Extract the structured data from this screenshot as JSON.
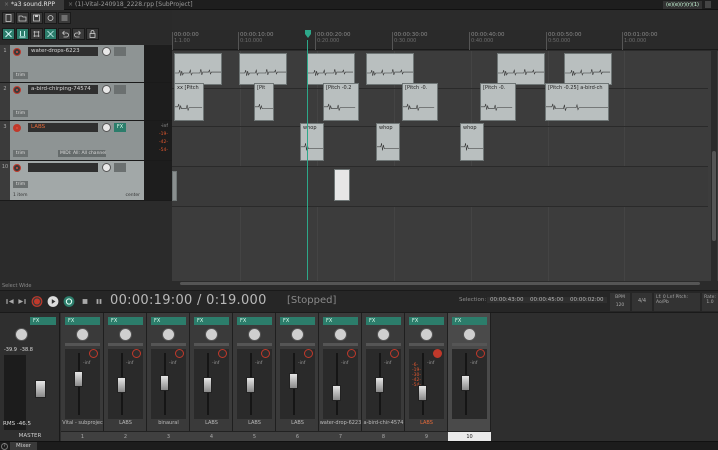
{
  "tabs": [
    {
      "label": "*a3 sound.RPP",
      "active": true
    },
    {
      "label": "(1)-Vital-240918_2228.rpp [SubProject]",
      "active": false
    }
  ],
  "topright_label": "(e)(e)(r)(r)(1)",
  "ruler": {
    "ticks": [
      {
        "main": "00:00:00",
        "sub": "1.1.00"
      },
      {
        "main": "00:00:10:00",
        "sub": "0:10.000"
      },
      {
        "main": "00:00:20:00",
        "sub": "0:20.000"
      },
      {
        "main": "00:00:30:00",
        "sub": "0:30.000"
      },
      {
        "main": "00:00:40:00",
        "sub": "0:40.000"
      },
      {
        "main": "00:00:50:00",
        "sub": "0:50.000"
      },
      {
        "main": "00:01:00:00",
        "sub": "1:00.000"
      }
    ]
  },
  "tracks": [
    {
      "num": "1",
      "name": "water-drops-6223",
      "trim": "trim",
      "red": false
    },
    {
      "num": "2",
      "name": "a-bird-chirping-74574",
      "trim": "trim",
      "red": false
    },
    {
      "num": "3",
      "name": "LABS",
      "trim": "trim",
      "channel": "MIDI: All: All channels",
      "red": true,
      "meter": [
        "-inf",
        "-19-",
        "-42-",
        "-54-"
      ]
    },
    {
      "num": "10",
      "name": "",
      "trim": "trim",
      "extra": "1 item",
      "pan": "center",
      "red": false
    }
  ],
  "items": {
    "row1": [
      "water-drops",
      "water-drops",
      "water-drops",
      "water-drops",
      "water-drops",
      "water-drops"
    ],
    "row2": [
      "xx [Pitch",
      "[Pit",
      "[Pitch -0.2",
      "[Pitch -0.",
      "[Pitch -0.",
      "[Pitch -0.25] a-bird-ch"
    ],
    "row3": [
      "whop",
      "whop",
      "whop"
    ]
  },
  "status_text": "Select Wide",
  "transport": {
    "time": "00:00:19:00 / 0:19.000",
    "state": "[Stopped]",
    "selection_label": "Selection:",
    "sel_start": "00:00:43:00",
    "sel_end": "00:00:45:00",
    "sel_len": "00:00:02:00",
    "bpm_label": "BPM",
    "bpm_value": "120",
    "rate_label": "4/4",
    "misc_label": "Lf: 0 Lnf\nPitch: Ao/Pb",
    "rate2_label": "Rate: 1.0"
  },
  "master": {
    "fx": "FX",
    "peak_l": "-39.9",
    "peak_r": "-38.8",
    "rms": "RMS -46.5",
    "name": "MASTER"
  },
  "mixer": {
    "strips": [
      {
        "name": "Vital - subprojec",
        "num": "1",
        "red": false,
        "rec_on": false
      },
      {
        "name": "LABS",
        "num": "2",
        "red": false,
        "rec_on": false
      },
      {
        "name": "binaural",
        "num": "3",
        "red": false,
        "rec_on": false
      },
      {
        "name": "LABS",
        "num": "4",
        "red": false,
        "rec_on": false
      },
      {
        "name": "LABS",
        "num": "5",
        "red": false,
        "rec_on": false
      },
      {
        "name": "LABS",
        "num": "6",
        "red": false,
        "rec_on": false
      },
      {
        "name": "water-drop-6223",
        "num": "7",
        "red": false,
        "rec_on": false
      },
      {
        "name": "a-bird-chir-4574",
        "num": "8",
        "red": false,
        "rec_on": false
      },
      {
        "name": "LABS",
        "num": "9",
        "red": true,
        "rec_on": true
      },
      {
        "name": "",
        "num": "10",
        "red": false,
        "rec_on": false
      }
    ],
    "fx_label": "FX",
    "inf": "-inf"
  },
  "bottom_tab": "Mixer",
  "colors": {
    "accent_teal": "#2c7d6b",
    "record_red": "#c0392b",
    "cursor": "#2da88a",
    "item_gray": "#b9bfbf"
  }
}
